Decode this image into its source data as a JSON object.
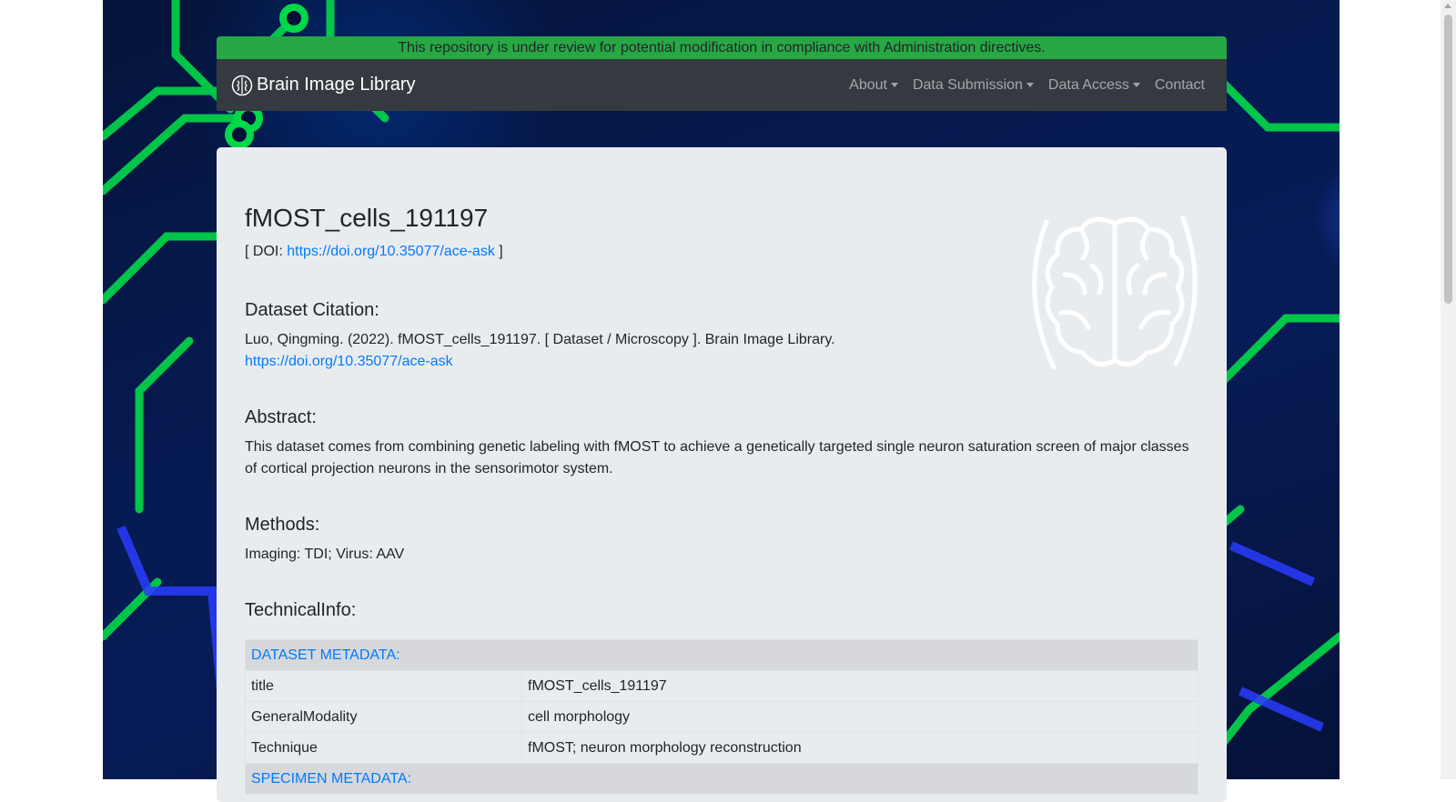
{
  "notice": {
    "text": "This repository is under review for potential modification in compliance with Administration directives."
  },
  "navbar": {
    "brand": "Brain Image Library",
    "items": [
      {
        "label": "About",
        "dropdown": true
      },
      {
        "label": "Data Submission",
        "dropdown": true
      },
      {
        "label": "Data Access",
        "dropdown": true
      },
      {
        "label": "Contact",
        "dropdown": false
      }
    ]
  },
  "dataset": {
    "title": "fMOST_cells_191197",
    "doi_prefix": "[ DOI: ",
    "doi_url": "https://doi.org/10.35077/ace-ask",
    "doi_suffix": " ]",
    "citation_heading": "Dataset Citation:",
    "citation_text": "Luo, Qingming. (2022). fMOST_cells_191197. [ Dataset / Microscopy ]. Brain Image Library.",
    "citation_url": "https://doi.org/10.35077/ace-ask",
    "abstract_heading": "Abstract:",
    "abstract_text": "This dataset comes from combining genetic labeling with fMOST to achieve a genetically targeted single neuron saturation screen of major classes of cortical projection neurons in the sensorimotor system.",
    "methods_heading": "Methods:",
    "methods_text": "Imaging: TDI; Virus: AAV",
    "technical_heading": "TechnicalInfo:"
  },
  "technical_table": {
    "dataset_metadata_label": "DATASET METADATA:",
    "rows": [
      {
        "key": "title",
        "value": "fMOST_cells_191197"
      },
      {
        "key": "GeneralModality",
        "value": "cell morphology"
      },
      {
        "key": "Technique",
        "value": "fMOST; neuron morphology reconstruction"
      }
    ],
    "specimen_metadata_label": "SPECIMEN METADATA:"
  },
  "colors": {
    "notice_bg": "#28a745",
    "navbar_bg": "#343a40",
    "card_bg": "#e9ecef",
    "link": "#007bff",
    "circuit_green": "#00e64d",
    "circuit_blue": "#2a3cff"
  },
  "icons": {
    "brand_logo": "brain-icon",
    "dataset_logo": "brain-icon"
  }
}
